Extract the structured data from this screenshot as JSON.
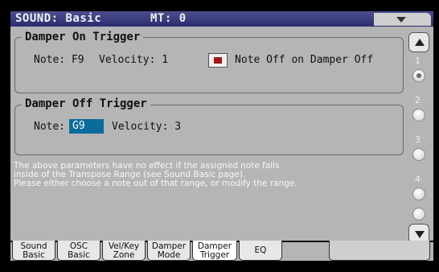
{
  "header": {
    "title": "SOUND: Basic",
    "mt": "MT: 0"
  },
  "damper_on": {
    "title": "Damper On Trigger",
    "note": "Note: F9",
    "velocity": "Velocity: 1",
    "checkbox_label": "Note Off on Damper Off",
    "checkbox_checked": true
  },
  "damper_off": {
    "title": "Damper Off Trigger",
    "note_label": "Note:",
    "note_value": "G9",
    "velocity": "Velocity: 3"
  },
  "info": {
    "line1": "The above parameters have no effect if the assigned note falls",
    "line2": "inside of the Transpose Range (see Sound Basic page).",
    "line3": "Please either choose a note out of that range, or modify the range."
  },
  "pages": [
    "1",
    "2",
    "3",
    "4"
  ],
  "active_page": 1,
  "tabs": [
    {
      "line1": "Sound",
      "line2": "Basic"
    },
    {
      "line1": "OSC",
      "line2": "Basic"
    },
    {
      "line1": "Vel/Key",
      "line2": "Zone"
    },
    {
      "line1": "Damper",
      "line2": "Mode"
    },
    {
      "line1": "Damper",
      "line2": "Trigger"
    },
    {
      "line1": "EQ",
      "line2": ""
    }
  ],
  "active_tab": 4,
  "colors": {
    "title_bar": "#3b3d7e",
    "panel_bg": "#b5b5b5",
    "selected_field": "#0a6c9a",
    "checkbox_fill": "#a3151a"
  }
}
